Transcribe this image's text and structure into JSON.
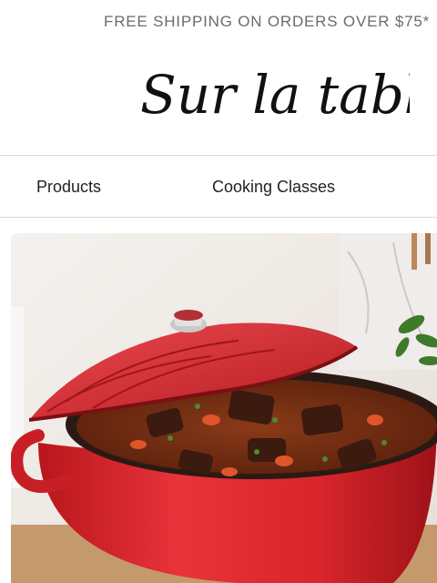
{
  "promo": {
    "text": "FREE SHIPPING ON ORDERS OVER $75*"
  },
  "brand": {
    "logo_text": "Sur la table"
  },
  "nav": {
    "items": [
      {
        "label": "Products"
      },
      {
        "label": "Cooking Classes"
      }
    ]
  },
  "hero": {
    "image_subject": "red-dutch-oven-stew",
    "colors": {
      "pot": "#d8262c",
      "stew": "#7a2e14"
    }
  }
}
